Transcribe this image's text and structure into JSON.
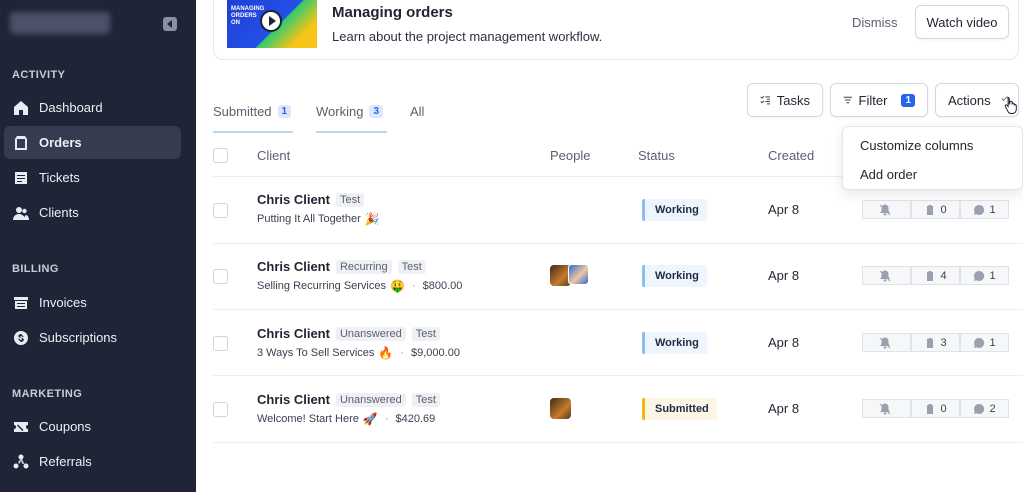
{
  "sidebar": {
    "sections": [
      "ACTIVITY",
      "BILLING",
      "MARKETING"
    ],
    "items": [
      {
        "label": "Dashboard",
        "icon": "home-icon"
      },
      {
        "label": "Orders",
        "icon": "orders-icon",
        "active": true
      },
      {
        "label": "Tickets",
        "icon": "tickets-icon"
      },
      {
        "label": "Clients",
        "icon": "clients-icon"
      },
      {
        "label": "Invoices",
        "icon": "invoices-icon"
      },
      {
        "label": "Subscriptions",
        "icon": "subscriptions-icon"
      },
      {
        "label": "Coupons",
        "icon": "coupons-icon"
      },
      {
        "label": "Referrals",
        "icon": "referrals-icon"
      }
    ]
  },
  "banner": {
    "thumb_text": "MANAGING ORDERS ON",
    "title": "Managing orders",
    "subtitle": "Learn about the project management workflow.",
    "dismiss_label": "Dismiss",
    "watch_label": "Watch video"
  },
  "tabs": [
    {
      "label": "Submitted",
      "count": "1"
    },
    {
      "label": "Working",
      "count": "3"
    },
    {
      "label": "All"
    }
  ],
  "toolbar": {
    "tasks_label": "Tasks",
    "filter_label": "Filter",
    "filter_count": "1",
    "actions_label": "Actions"
  },
  "actions_menu": [
    "Customize columns",
    "Add order"
  ],
  "table": {
    "headers": [
      "Client",
      "People",
      "Status",
      "Created"
    ],
    "rows": [
      {
        "client": "Chris Client",
        "tags": [
          "Test"
        ],
        "service": "Putting It All Together",
        "emoji": "🎉",
        "price": "",
        "status": "Working",
        "created": "Apr 8",
        "tasks": "0",
        "messages": "1"
      },
      {
        "client": "Chris Client",
        "tags": [
          "Recurring",
          "Test"
        ],
        "service": "Selling Recurring Services",
        "emoji": "🤑",
        "price": "$800.00",
        "status": "Working",
        "created": "Apr 8",
        "tasks": "4",
        "messages": "1"
      },
      {
        "client": "Chris Client",
        "tags": [
          "Unanswered",
          "Test"
        ],
        "service": "3 Ways To Sell Services",
        "emoji": "🔥",
        "price": "$9,000.00",
        "status": "Working",
        "created": "Apr 8",
        "tasks": "3",
        "messages": "1"
      },
      {
        "client": "Chris Client",
        "tags": [
          "Unanswered",
          "Test"
        ],
        "service": "Welcome! Start Here",
        "emoji": "🚀",
        "price": "$420.69",
        "status": "Submitted",
        "created": "Apr 8",
        "tasks": "0",
        "messages": "2"
      }
    ]
  },
  "colors": {
    "sidebar_bg": "#1f2537",
    "accent": "#2563eb",
    "working": "#8cbdf0",
    "submitted": "#f1b810"
  }
}
